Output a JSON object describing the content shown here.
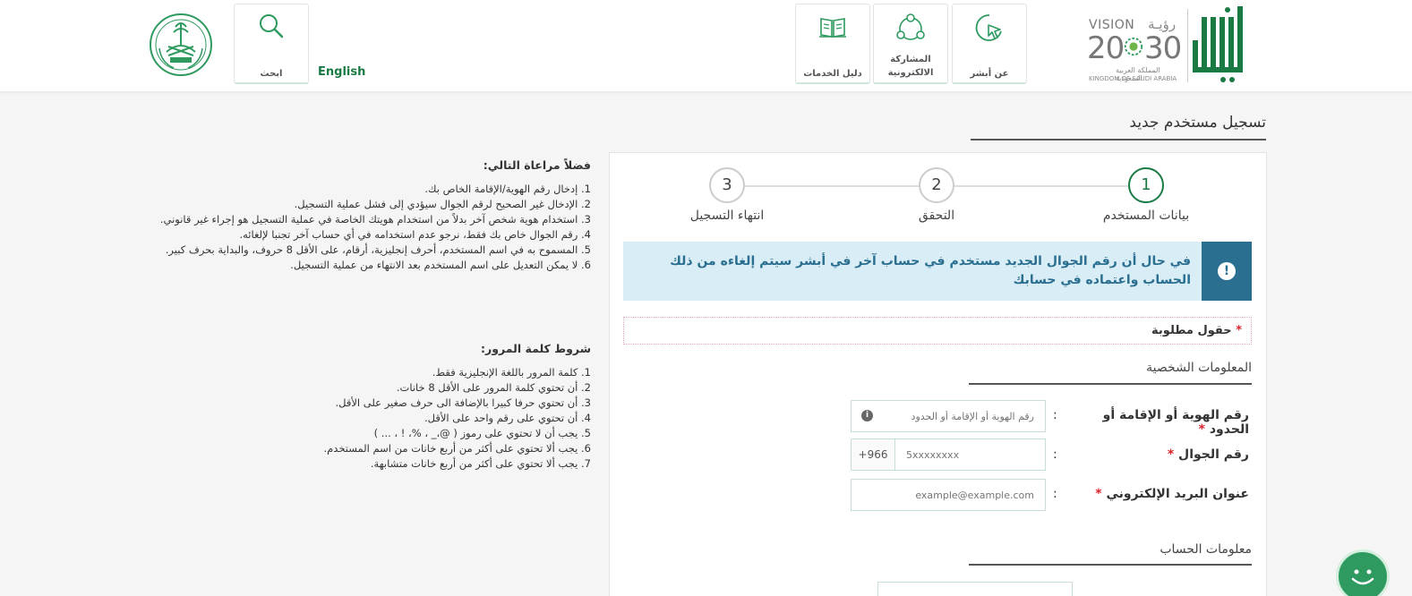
{
  "header": {
    "nav": [
      {
        "label": "عن أبشر",
        "icon": "cursor-click-icon"
      },
      {
        "label": "المشاركة الالكترونية",
        "icon": "network-icon"
      },
      {
        "label": "دليل الخدمات",
        "icon": "book-icon"
      }
    ],
    "search_label": "ابحث",
    "english_label": "English",
    "vision_text": "VISION",
    "vision_arabic": "رؤيـة",
    "vision_year_left": "20",
    "vision_year_right": "30",
    "vision_kingdom_ar": "المملكة العربية السعودية",
    "vision_kingdom_en": "KINGDOM OF SAUDI ARABIA"
  },
  "page": {
    "title": "تسجيل مستخدم جديد"
  },
  "steps": [
    {
      "number": "1",
      "label": "بيانات المستخدم",
      "active": true
    },
    {
      "number": "2",
      "label": "التحقق",
      "active": false
    },
    {
      "number": "3",
      "label": "انتهاء التسجيل",
      "active": false
    }
  ],
  "alert": {
    "text": "في حال أن رقم الجوال الجديد مستخدم في حساب آخر في أبشر سيتم إلغاءه من ذلك الحساب واعتماده في حسابك"
  },
  "required_note": "حقول مطلوبة",
  "personal_section": "المعلومات الشخصية",
  "fields": {
    "id": {
      "label": "رقم الهوية أو الإقامة أو الحدود",
      "placeholder": "رقم الهوية أو الإقامة أو الحدود",
      "value": ""
    },
    "mobile": {
      "label": "رقم الجوال",
      "prefix": "+966",
      "placeholder": "5xxxxxxxx",
      "value": ""
    },
    "email": {
      "label": "عنوان البريد الإلكتروني",
      "placeholder": "example@example.com",
      "value": ""
    }
  },
  "account_section": "معلومات الحساب",
  "notes": {
    "title": "فضلاً مراعاة التالي:",
    "items": [
      "1. إدخال رقم الهوية/الإقامة الخاص بك.",
      "2. الإدخال غير الصحيح لرقم الجوال سيؤدي إلى فشل عملية التسجيل.",
      "3. استخدام هوية شخص آخر بدلاً من استخدام هويتك الخاصة في عملية التسجيل هو إجراء غير قانوني.",
      "4. رقم الجوال خاص بك فقط، نرجو عدم استخدامه في أي حساب آخر تجنبا لإلغائه.",
      "5. المسموح به في اسم المستخدم، أحرف إنجليزية، أرقام، على الأقل 8 حروف، والبداية بحرف كبير.",
      "6. لا يمكن التعديل على اسم المستخدم بعد الانتهاء من عملية التسجيل."
    ]
  },
  "password_rules": {
    "title": "شروط كلمة المرور:",
    "items": [
      "1. كلمة المرور باللغة الإنجليزية فقط.",
      "2. أن تحتوي كلمة المرور على الأقل 8 خانات.",
      "3. أن تحتوي حرفا كبيرا بالإضافة الى حرف صغير على الأقل.",
      "4. أن تحتوي على رقم واحد على الأقل.",
      "5. يجب أن لا تحتوي على رموز ( @،_ ، %، ! ، ... )",
      "6. يجب ألا تحتوي على أكثر من أربع خانات من اسم المستخدم.",
      "7. يجب ألا تحتوي على أكثر من أربع خانات متشابهة."
    ]
  },
  "colors": {
    "brand_green": "#1a7a44",
    "alert_bg": "#d9edf7",
    "alert_blue": "#2a6f90",
    "required_red": "#d9232d"
  }
}
